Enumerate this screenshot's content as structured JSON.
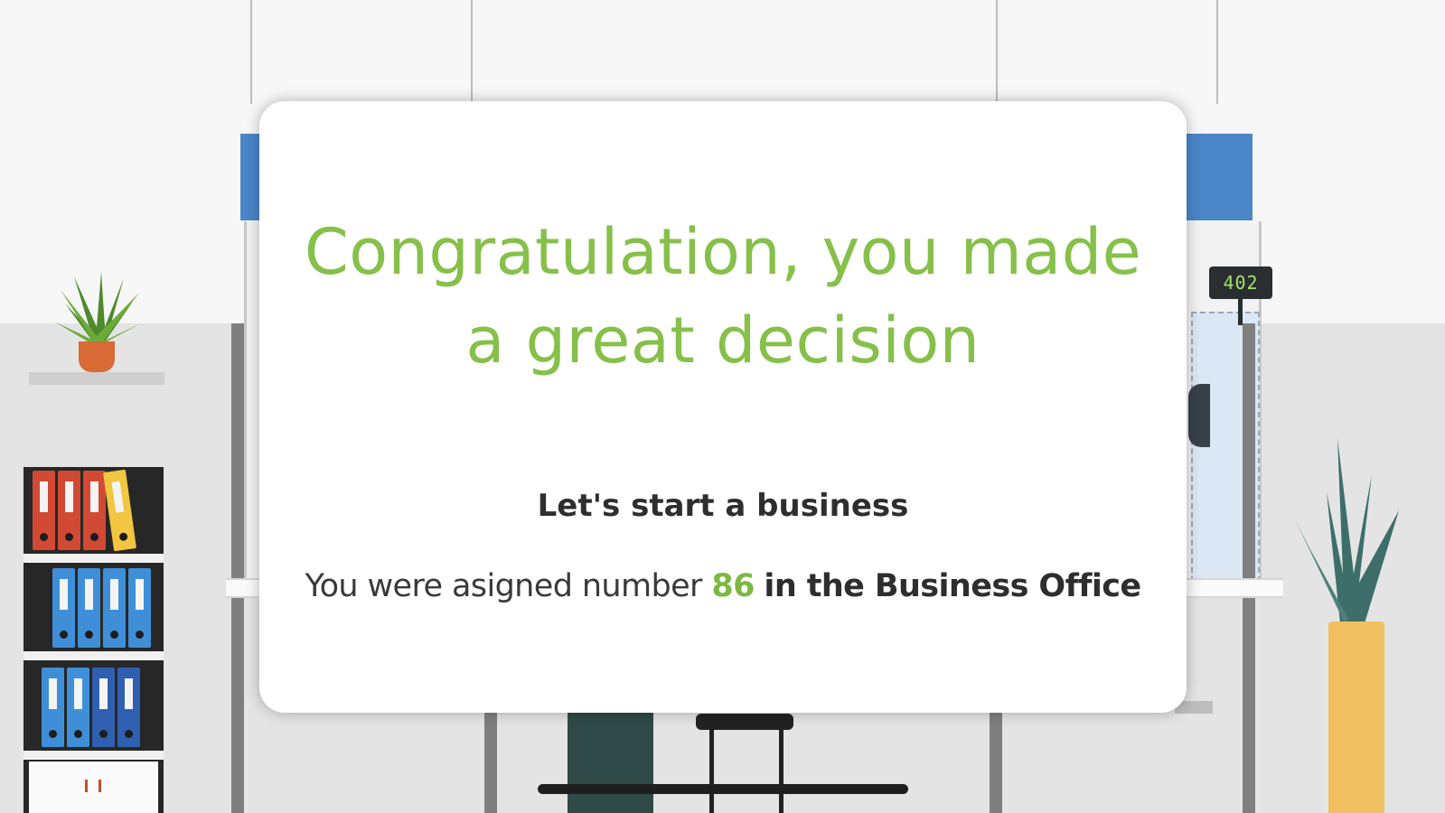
{
  "counter_display": "402",
  "dialog": {
    "headline": "Congratulation, you made a great decision",
    "subtitle": "Let's start a business",
    "assignment_prefix": "You were asigned number",
    "assigned_number": "86",
    "assignment_suffix": "in the Business Office"
  },
  "colors": {
    "headline": "#86c04a",
    "number": "#7cb842",
    "sign_blue": "#4a86c8"
  }
}
